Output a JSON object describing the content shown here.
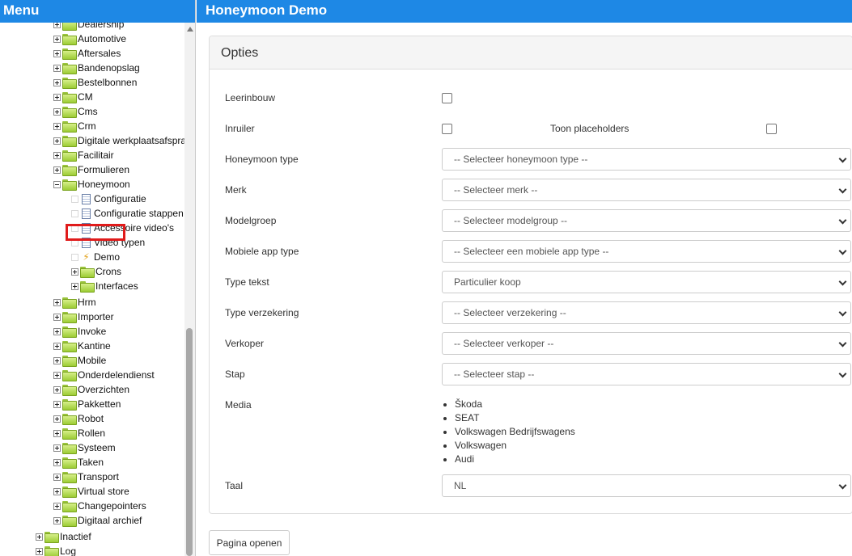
{
  "menu": {
    "title": "Menu",
    "items": [
      {
        "label": "Dealership",
        "depth": 1,
        "kind": "folder",
        "toggle": "plus"
      },
      {
        "label": "Automotive",
        "depth": 1,
        "kind": "folder",
        "toggle": "plus"
      },
      {
        "label": "Aftersales",
        "depth": 1,
        "kind": "folder",
        "toggle": "plus"
      },
      {
        "label": "Bandenopslag",
        "depth": 1,
        "kind": "folder",
        "toggle": "plus"
      },
      {
        "label": "Bestelbonnen",
        "depth": 1,
        "kind": "folder",
        "toggle": "plus"
      },
      {
        "label": "CM",
        "depth": 1,
        "kind": "folder",
        "toggle": "plus"
      },
      {
        "label": "Cms",
        "depth": 1,
        "kind": "folder",
        "toggle": "plus"
      },
      {
        "label": "Crm",
        "depth": 1,
        "kind": "folder",
        "toggle": "plus"
      },
      {
        "label": "Digitale werkplaatsafspra",
        "depth": 1,
        "kind": "folder",
        "toggle": "plus"
      },
      {
        "label": "Facilitair",
        "depth": 1,
        "kind": "folder",
        "toggle": "plus"
      },
      {
        "label": "Formulieren",
        "depth": 1,
        "kind": "folder",
        "toggle": "plus"
      },
      {
        "label": "Honeymoon",
        "depth": 1,
        "kind": "folder",
        "toggle": "minus"
      },
      {
        "label": "Configuratie",
        "depth": 2,
        "kind": "doc",
        "toggle": "blank"
      },
      {
        "label": "Configuratie stappen",
        "depth": 2,
        "kind": "doc",
        "toggle": "blank"
      },
      {
        "label": "Accessoire video's",
        "depth": 2,
        "kind": "doc",
        "toggle": "blank"
      },
      {
        "label": "Video typen",
        "depth": 2,
        "kind": "doc",
        "toggle": "blank"
      },
      {
        "label": "Demo",
        "depth": 2,
        "kind": "action",
        "toggle": "blank",
        "selected": true
      },
      {
        "label": "Crons",
        "depth": 2,
        "kind": "folder",
        "toggle": "plus"
      },
      {
        "label": "Interfaces",
        "depth": 2,
        "kind": "folder",
        "toggle": "plus"
      },
      {
        "label": "Hrm",
        "depth": 1,
        "kind": "folder",
        "toggle": "plus"
      },
      {
        "label": "Importer",
        "depth": 1,
        "kind": "folder",
        "toggle": "plus"
      },
      {
        "label": "Invoke",
        "depth": 1,
        "kind": "folder",
        "toggle": "plus"
      },
      {
        "label": "Kantine",
        "depth": 1,
        "kind": "folder",
        "toggle": "plus"
      },
      {
        "label": "Mobile",
        "depth": 1,
        "kind": "folder",
        "toggle": "plus"
      },
      {
        "label": "Onderdelendienst",
        "depth": 1,
        "kind": "folder",
        "toggle": "plus"
      },
      {
        "label": "Overzichten",
        "depth": 1,
        "kind": "folder",
        "toggle": "plus"
      },
      {
        "label": "Pakketten",
        "depth": 1,
        "kind": "folder",
        "toggle": "plus"
      },
      {
        "label": "Robot",
        "depth": 1,
        "kind": "folder",
        "toggle": "plus"
      },
      {
        "label": "Rollen",
        "depth": 1,
        "kind": "folder",
        "toggle": "plus"
      },
      {
        "label": "Systeem",
        "depth": 1,
        "kind": "folder",
        "toggle": "plus"
      },
      {
        "label": "Taken",
        "depth": 1,
        "kind": "folder",
        "toggle": "plus"
      },
      {
        "label": "Transport",
        "depth": 1,
        "kind": "folder",
        "toggle": "plus"
      },
      {
        "label": "Virtual store",
        "depth": 1,
        "kind": "folder",
        "toggle": "plus"
      },
      {
        "label": "Changepointers",
        "depth": 1,
        "kind": "folder",
        "toggle": "plus"
      },
      {
        "label": "Digitaal archief",
        "depth": 1,
        "kind": "folder",
        "toggle": "plus"
      },
      {
        "label": "Inactief",
        "depth": 0,
        "kind": "folder",
        "toggle": "plus"
      },
      {
        "label": "Log",
        "depth": 0,
        "kind": "folder",
        "toggle": "plus"
      }
    ]
  },
  "page": {
    "title": "Honeymoon Demo",
    "panel_title": "Opties"
  },
  "form": {
    "leerinbouw_label": "Leerinbouw",
    "inruiler_label": "Inruiler",
    "toon_placeholders_label": "Toon placeholders",
    "honeymoon_type_label": "Honeymoon type",
    "honeymoon_type_value": "-- Selecteer honeymoon type --",
    "merk_label": "Merk",
    "merk_value": "-- Selecteer merk --",
    "modelgroep_label": "Modelgroep",
    "modelgroep_value": "-- Selecteer modelgroup --",
    "mobiele_app_type_label": "Mobiele app type",
    "mobiele_app_type_value": "-- Selecteer een mobiele app type --",
    "type_tekst_label": "Type tekst",
    "type_tekst_value": "Particulier koop",
    "type_verzekering_label": "Type verzekering",
    "type_verzekering_value": "-- Selecteer verzekering --",
    "verkoper_label": "Verkoper",
    "verkoper_value": "-- Selecteer verkoper --",
    "stap_label": "Stap",
    "stap_value": "-- Selecteer stap --",
    "media_label": "Media",
    "media": [
      "Škoda",
      "SEAT",
      "Volkswagen Bedrijfswagens",
      "Volkswagen",
      "Audi"
    ],
    "taal_label": "Taal",
    "taal_value": "NL"
  },
  "actions": {
    "open_page_label": "Pagina openen"
  }
}
